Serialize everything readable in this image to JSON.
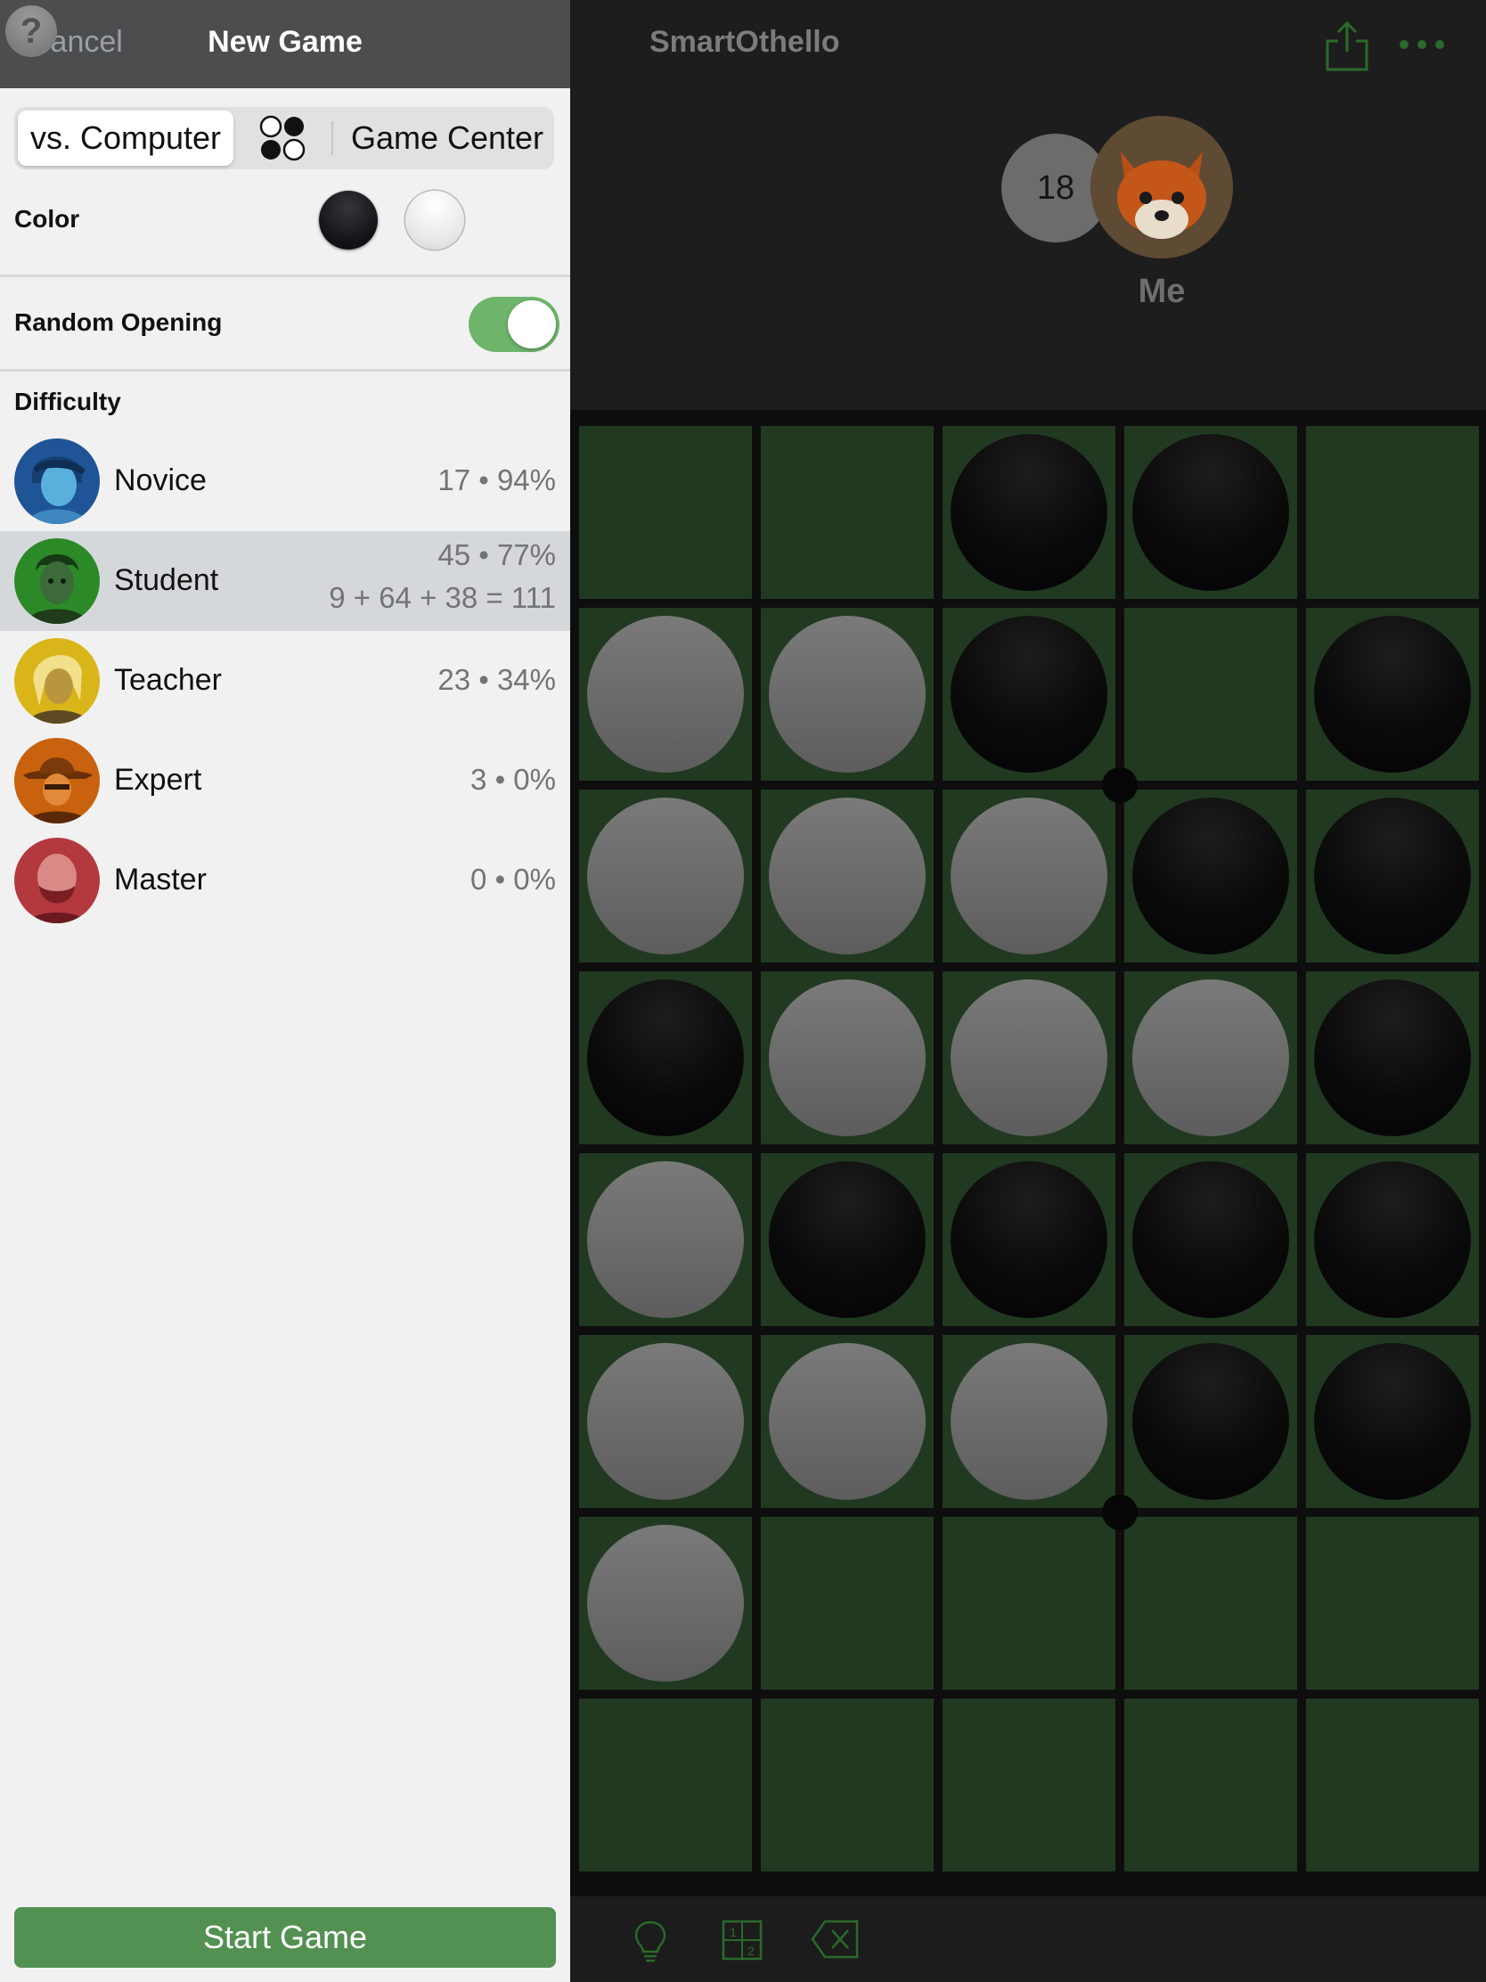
{
  "nav": {
    "cancel": "Cancel",
    "title": "New Game"
  },
  "opponent_segment": {
    "computer": "vs. Computer",
    "local_icon": "two-player-discs-icon",
    "game_center": "Game Center",
    "selected": "vs. Computer"
  },
  "color": {
    "label": "Color",
    "options": [
      "black",
      "white",
      "random"
    ],
    "random_glyph": "?",
    "selected": "random"
  },
  "random_opening": {
    "label": "Random Opening",
    "on": true
  },
  "difficulty": {
    "label": "Difficulty",
    "levels": [
      {
        "name": "Novice",
        "stats": "17 • 94%",
        "avatar_color": "#2f6fb0"
      },
      {
        "name": "Student",
        "stats": "45 • 77%",
        "detail": "9 + 64 + 38 = 111",
        "avatar_color": "#2f8a2c",
        "selected": true
      },
      {
        "name": "Teacher",
        "stats": "23 • 34%",
        "avatar_color": "#d8b416"
      },
      {
        "name": "Expert",
        "stats": "3 • 0%",
        "avatar_color": "#c9650f"
      },
      {
        "name": "Master",
        "stats": "0 • 0%",
        "avatar_color": "#b63b3f"
      }
    ]
  },
  "start_button": "Start Game",
  "game": {
    "title": "SmartOthello",
    "score": "18",
    "player_name": "Me",
    "board": [
      "..BB.",
      "WWB.B",
      "WWWBB",
      "BWWWB",
      "WBBBB",
      "WWWBB",
      "W....",
      "....."
    ],
    "toolbar_icons": [
      "hint-bulb-icon",
      "numbering-icon",
      "undo-delete-icon"
    ]
  },
  "colors": {
    "accent_green": "#529151",
    "toggle_green": "#6fb46b",
    "board_green": "#213921"
  }
}
